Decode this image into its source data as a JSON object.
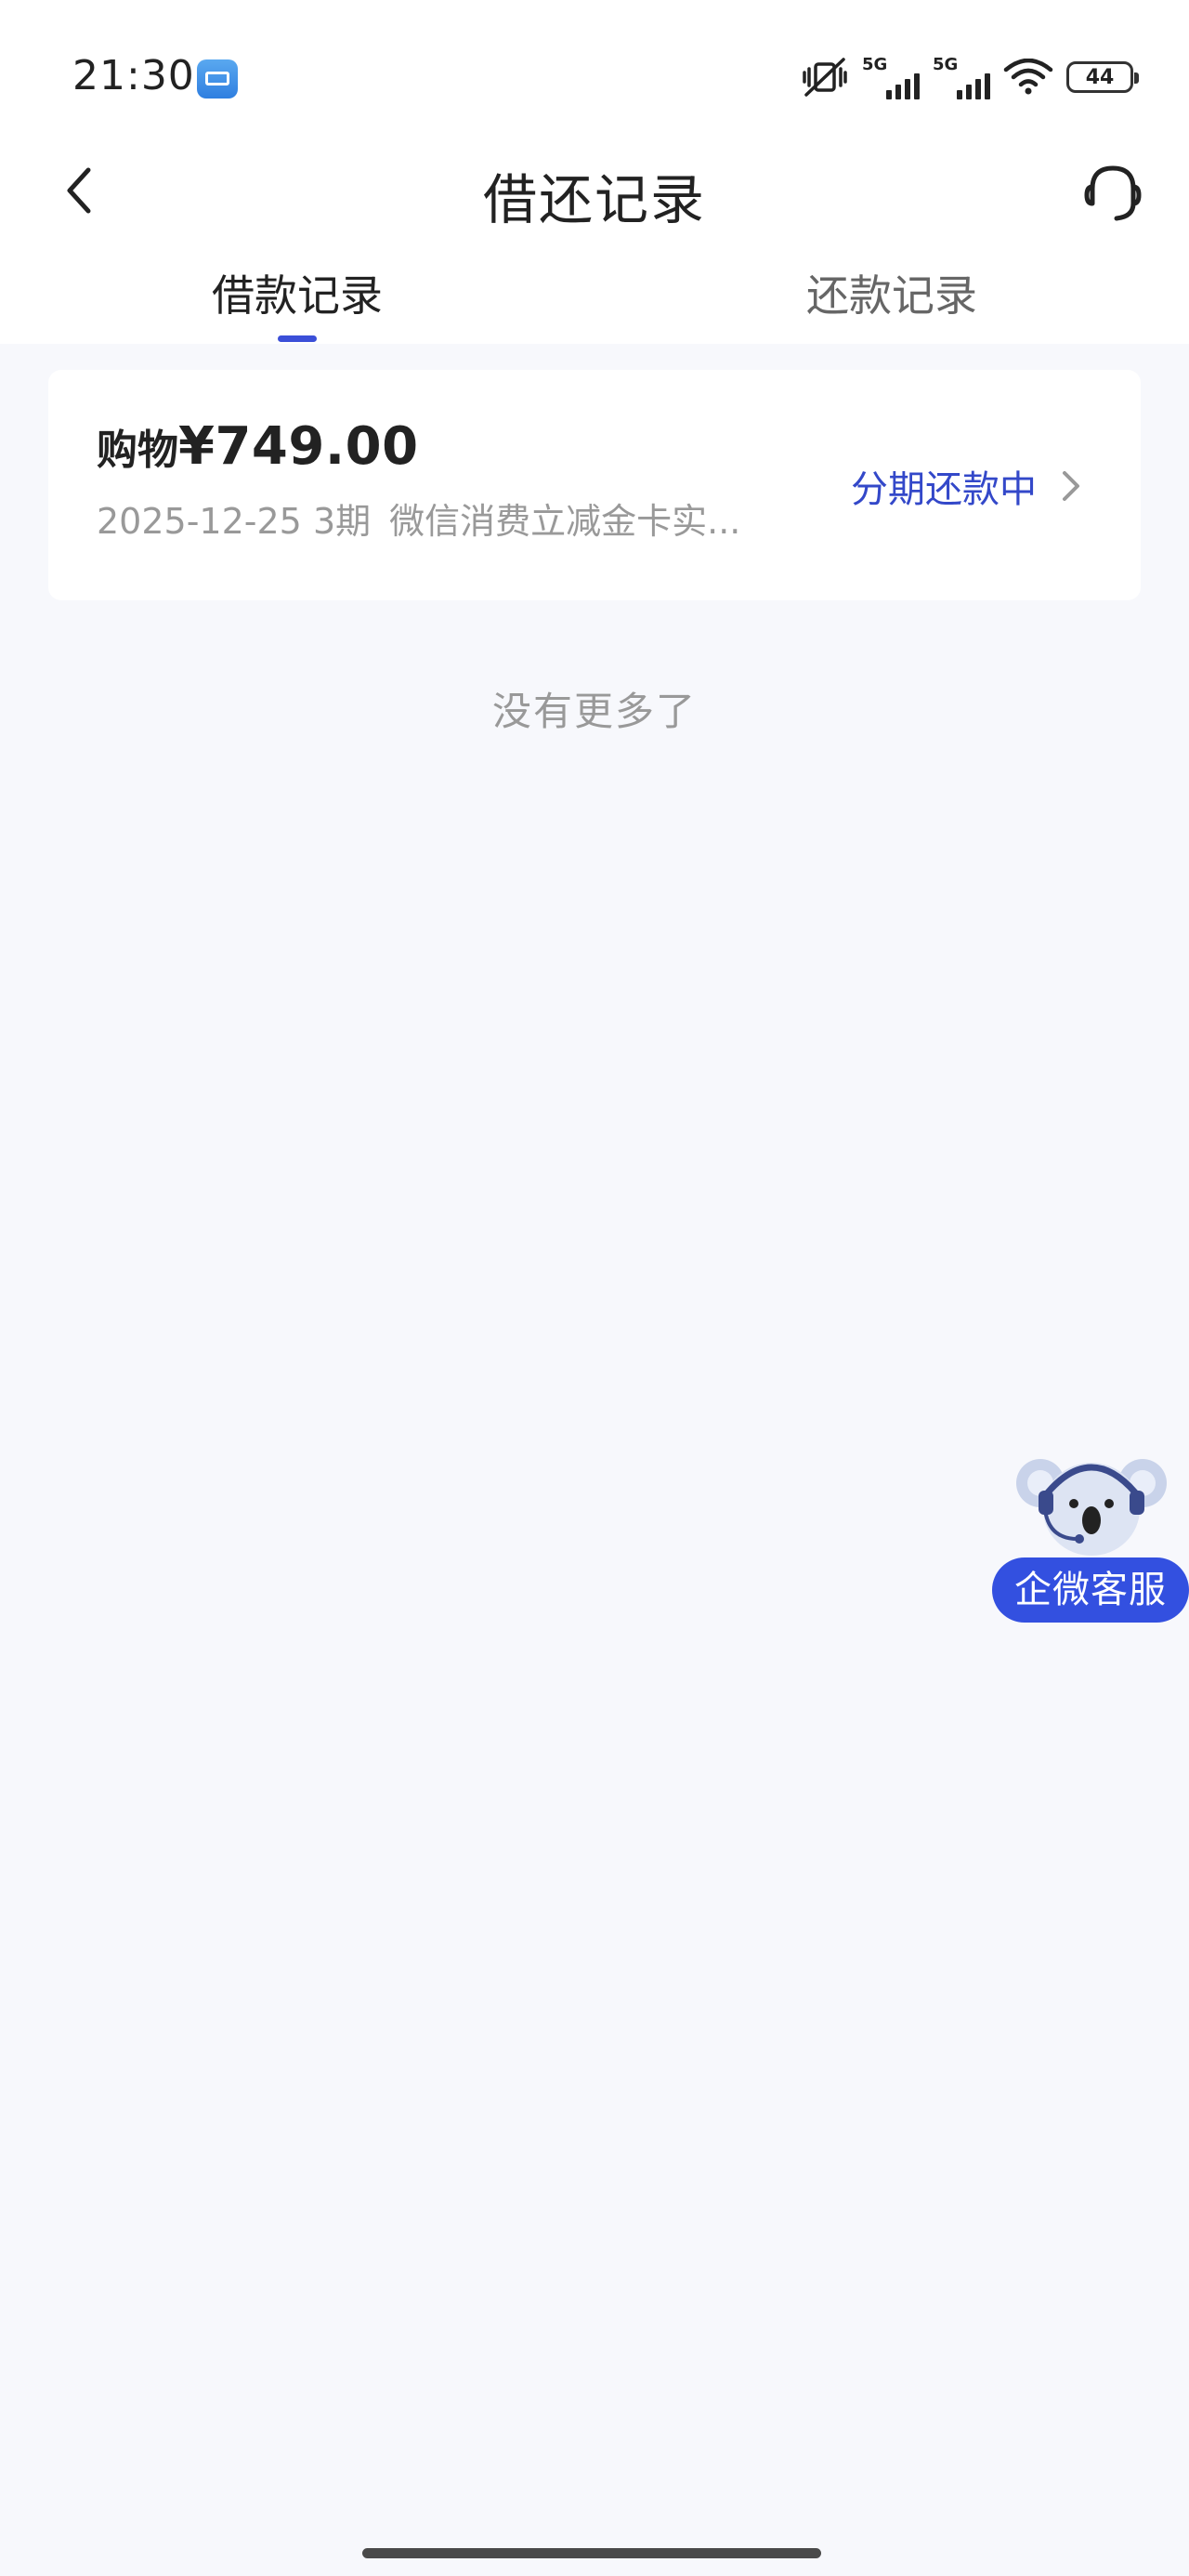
{
  "status_bar": {
    "time": "21:30",
    "network1": "5G",
    "network2": "5G",
    "battery": "44"
  },
  "header": {
    "title": "借还记录"
  },
  "tabs": [
    {
      "label": "借款记录",
      "active": true
    },
    {
      "label": "还款记录",
      "active": false
    }
  ],
  "records": [
    {
      "category": "购物",
      "amount": "¥749.00",
      "date": "2025-12-25",
      "term": "3期",
      "description": "微信消费立减金卡实...",
      "status": "分期还款中"
    }
  ],
  "list_end_text": "没有更多了",
  "floating_service": {
    "label": "企微客服"
  },
  "colors": {
    "accent": "#3348c9",
    "tab_indicator": "#3b4fd8",
    "float_button": "#3350e0",
    "page_background": "#f7f8fc"
  },
  "icons": {
    "back": "chevron-left-icon",
    "service": "headset-icon",
    "status_arrow": "chevron-right-icon",
    "mute": "vibrate-mute-icon",
    "wifi": "wifi-icon",
    "app": "mail-app-icon"
  }
}
